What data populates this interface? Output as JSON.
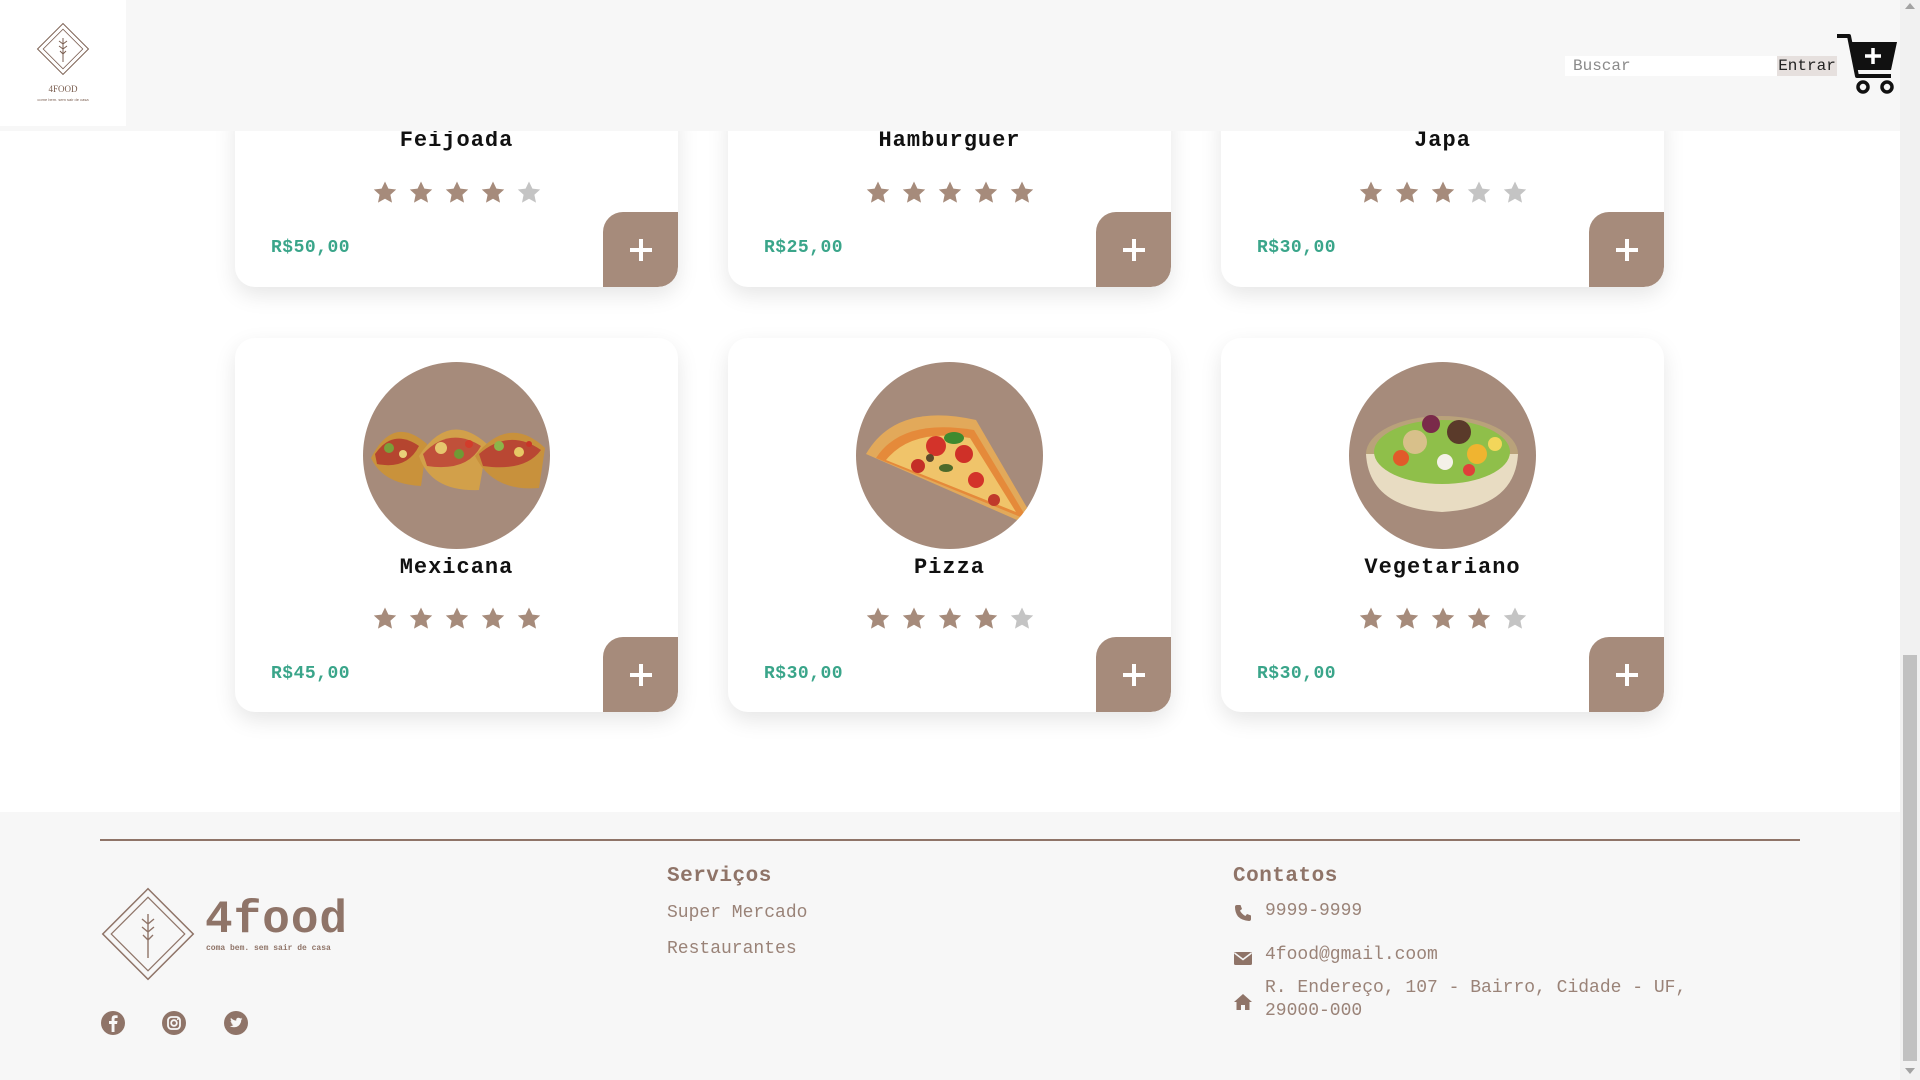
{
  "header": {
    "logo_name": "4FOOD",
    "logo_tagline": "come bem. sem sair de casa",
    "search_placeholder": "Buscar",
    "enter_label": "Entrar",
    "cart_icon": "cart-plus-icon"
  },
  "products": [
    {
      "name": "Feijoada",
      "rating": 4,
      "max_rating": 5,
      "price": "R$50,00"
    },
    {
      "name": "Hamburguer",
      "rating": 5,
      "max_rating": 5,
      "price": "R$25,00"
    },
    {
      "name": "Japa",
      "rating": 3,
      "max_rating": 5,
      "price": "R$30,00"
    },
    {
      "name": "Mexicana",
      "rating": 5,
      "max_rating": 5,
      "price": "R$45,00",
      "image": "tacos"
    },
    {
      "name": "Pizza",
      "rating": 4,
      "max_rating": 5,
      "price": "R$30,00",
      "image": "pizza-slice"
    },
    {
      "name": "Vegetariano",
      "rating": 4,
      "max_rating": 5,
      "price": "R$30,00",
      "image": "salad-bowl"
    }
  ],
  "footer": {
    "brand": "4food",
    "tagline": "coma bem. sem sair de casa",
    "services": {
      "title": "Serviços",
      "links": [
        "Super Mercado",
        "Restaurantes"
      ]
    },
    "contacts": {
      "title": "Contatos",
      "phone": "9999-9999",
      "email": "4food@gmail.coom",
      "address_line1": "R. Endereço, 107 - Bairro, Cidade - UF,",
      "address_line2": "29000-000"
    },
    "social": [
      "facebook-icon",
      "instagram-icon",
      "twitter-icon"
    ]
  },
  "colors": {
    "accent": "#a68b7b",
    "price": "#3aa58a",
    "footer_text": "#8f7468",
    "star_empty": "#c4c4c4"
  }
}
